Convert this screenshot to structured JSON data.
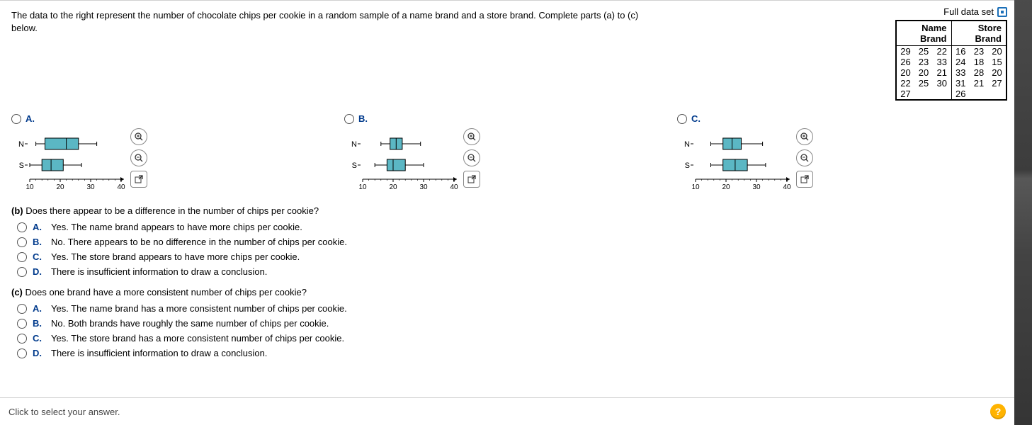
{
  "intro": "The data to the right represent the number of chocolate chips per cookie in a random sample of a name brand and a store brand. Complete parts (a) to (c) below.",
  "full_data_set_label": "Full data set",
  "table": {
    "headers": [
      "Name Brand",
      "Store Brand"
    ],
    "name_brand": [
      [
        29,
        25,
        22
      ],
      [
        26,
        23,
        33
      ],
      [
        20,
        20,
        21
      ],
      [
        22,
        25,
        30
      ],
      [
        27,
        null,
        null
      ]
    ],
    "store_brand": [
      [
        16,
        23,
        20
      ],
      [
        24,
        18,
        15
      ],
      [
        33,
        28,
        20
      ],
      [
        31,
        21,
        27
      ],
      [
        26,
        null,
        null
      ]
    ]
  },
  "plot_choices": {
    "A": {
      "label": "A."
    },
    "B": {
      "label": "B."
    },
    "C": {
      "label": "C."
    }
  },
  "axis_labels": {
    "N": "N",
    "S": "S"
  },
  "axis_ticks": [
    "10",
    "20",
    "30",
    "40"
  ],
  "chart_data": [
    {
      "type": "boxplot-pair",
      "option": "A",
      "x_range": [
        10,
        40
      ],
      "N": {
        "whisker_lo": 12,
        "q1": 15,
        "median": 22,
        "q3": 26,
        "whisker_hi": 32
      },
      "S": {
        "whisker_lo": 10,
        "q1": 14,
        "median": 17,
        "q3": 21,
        "whisker_hi": 27
      }
    },
    {
      "type": "boxplot-pair",
      "option": "B",
      "x_range": [
        10,
        40
      ],
      "N": {
        "whisker_lo": 16,
        "q1": 19,
        "median": 21,
        "q3": 23,
        "whisker_hi": 29
      },
      "S": {
        "whisker_lo": 14,
        "q1": 18,
        "median": 20,
        "q3": 24,
        "whisker_hi": 30
      }
    },
    {
      "type": "boxplot-pair",
      "option": "C",
      "x_range": [
        10,
        40
      ],
      "N": {
        "whisker_lo": 15,
        "q1": 19,
        "median": 22,
        "q3": 25,
        "whisker_hi": 32
      },
      "S": {
        "whisker_lo": 15,
        "q1": 19,
        "median": 23,
        "q3": 27,
        "whisker_hi": 33
      }
    }
  ],
  "question_b": {
    "prefix": "(b) ",
    "prompt": "Does there appear to be a difference in the number of chips per cookie?",
    "options": {
      "A": "Yes. The name brand appears to have more chips per cookie.",
      "B": "No. There appears to be no difference in the number of chips per cookie.",
      "C": "Yes. The store brand appears to have more chips per cookie.",
      "D": "There is insufficient information to draw a conclusion."
    }
  },
  "question_c": {
    "prefix": "(c) ",
    "prompt": "Does one brand have a more consistent number of chips per cookie?",
    "options": {
      "A": "Yes. The name brand has a more consistent number of chips per cookie.",
      "B": "No. Both brands have roughly the same number of chips per cookie.",
      "C": "Yes. The store brand has a more consistent number of chips per cookie.",
      "D": "There is insufficient information to draw a conclusion."
    }
  },
  "opt_labels": {
    "A": "A.",
    "B": "B.",
    "C": "C.",
    "D": "D."
  },
  "footer_text": "Click to select your answer.",
  "help": "?"
}
